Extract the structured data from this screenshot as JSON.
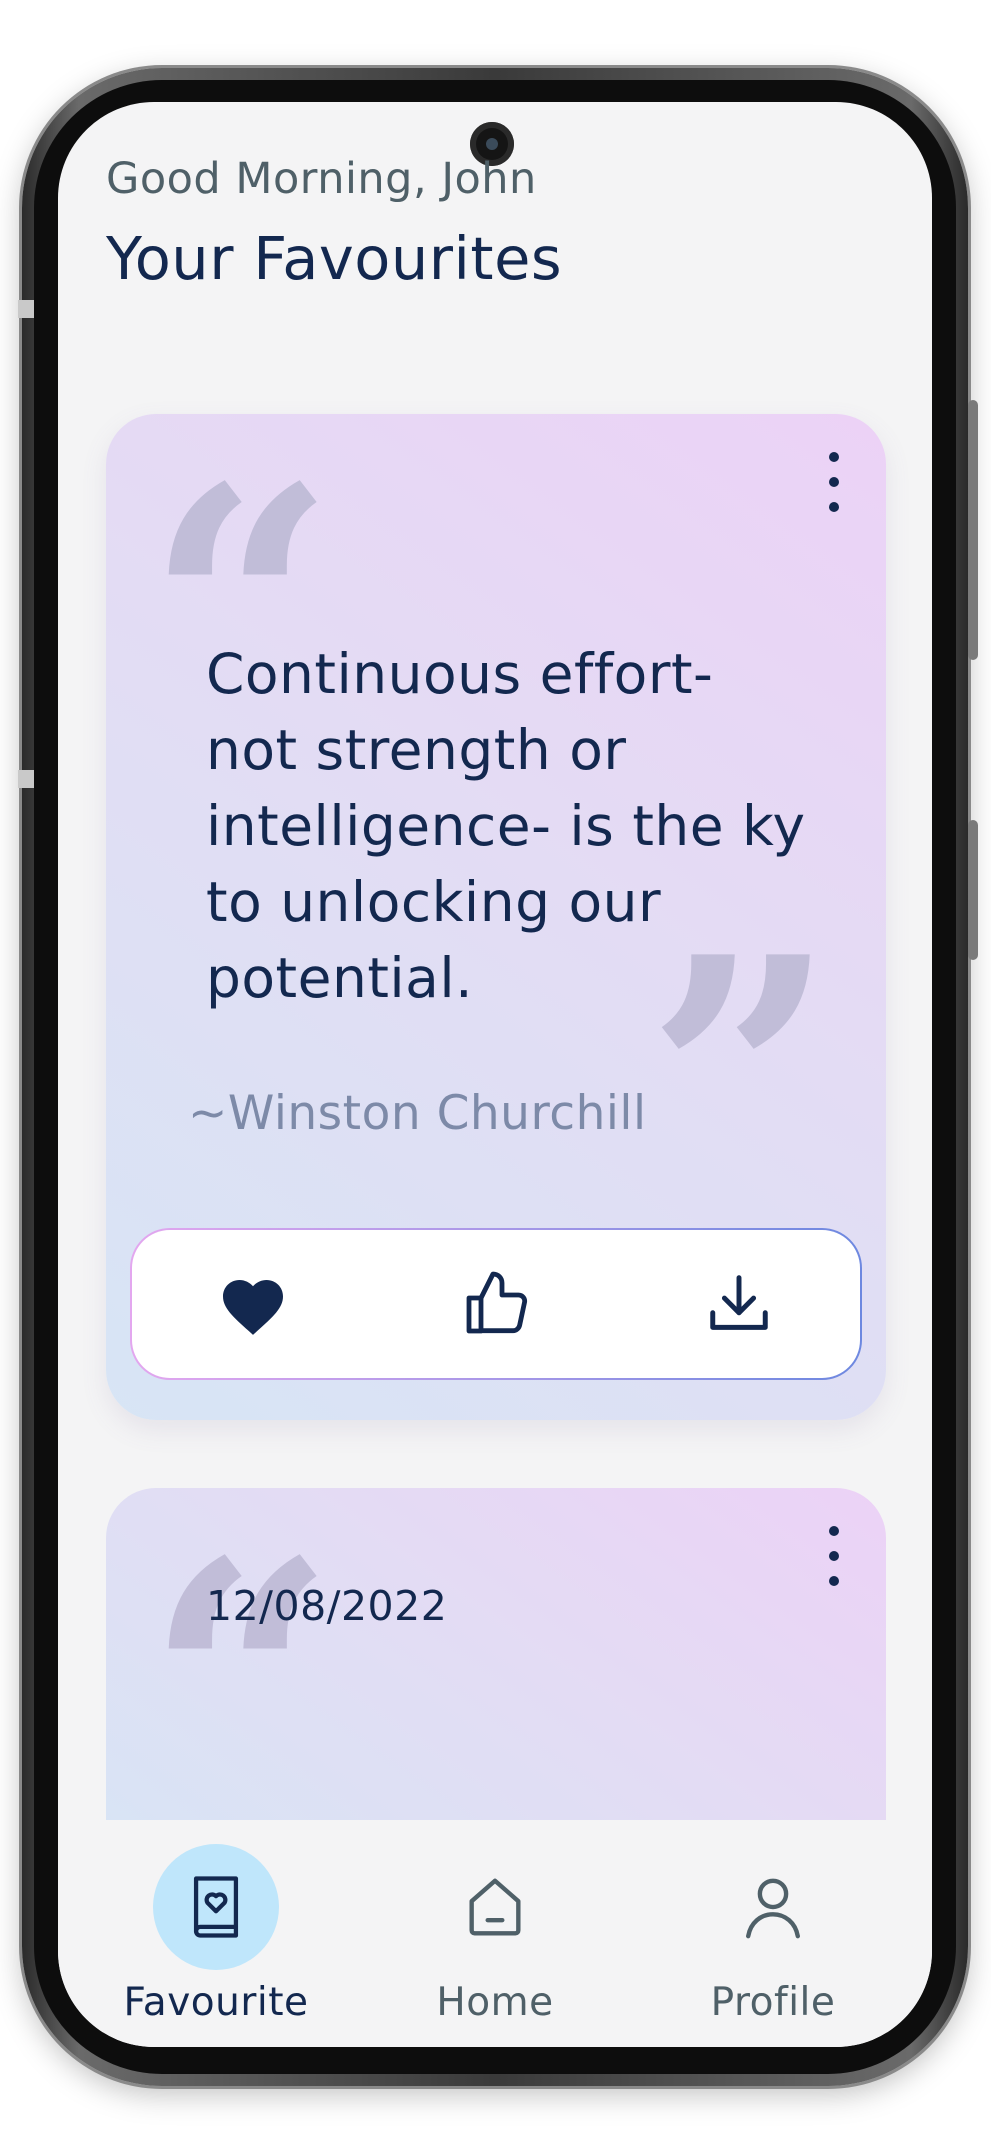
{
  "header": {
    "greeting": "Good Morning, John",
    "title": "Your Favourites"
  },
  "cards": [
    {
      "quote": "Continuous effort- not strength or intelligence- is the ky to unlocking our potential.",
      "author": "~Winston Churchill",
      "menu_icon": "more-vertical-icon",
      "actions": [
        {
          "icon": "heart-filled-icon",
          "label": "favourite"
        },
        {
          "icon": "thumbs-up-icon",
          "label": "like"
        },
        {
          "icon": "download-icon",
          "label": "download"
        }
      ]
    },
    {
      "date": "12/08/2022",
      "menu_icon": "more-vertical-icon"
    }
  ],
  "nav": {
    "items": [
      {
        "label": "Favourite",
        "icon": "book-heart-icon",
        "active": true
      },
      {
        "label": "Home",
        "icon": "home-icon",
        "active": false
      },
      {
        "label": "Profile",
        "icon": "user-icon",
        "active": false
      }
    ]
  },
  "colors": {
    "primary_text": "#13284f",
    "secondary_text": "#4f6068",
    "author_text": "#7d8aa8",
    "card_gradient_top": "#ecd2f6",
    "card_gradient_bottom": "#d7e5f5",
    "active_nav_bg": "#bfe6fb",
    "screen_bg": "#f4f4f5"
  }
}
